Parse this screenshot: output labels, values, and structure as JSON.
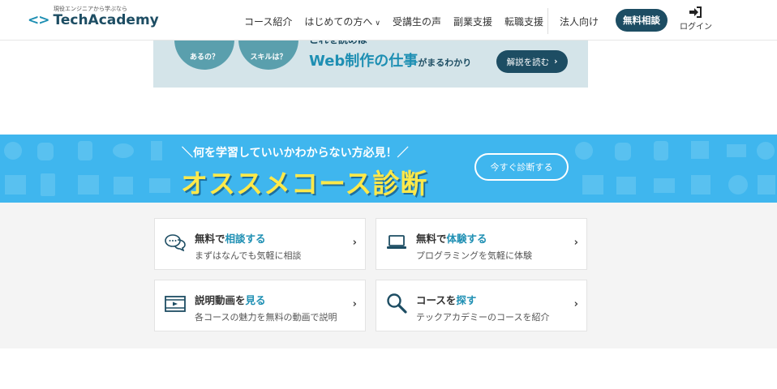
{
  "header": {
    "logo_tagline": "現役エンジニアから学ぶなら",
    "logo_mark": "<>",
    "logo_name": "TechAcademy",
    "nav": [
      {
        "label": "コース紹介"
      },
      {
        "label": "はじめての方へ",
        "has_dropdown": true
      },
      {
        "label": "受講生の声"
      },
      {
        "label": "副業支援"
      },
      {
        "label": "転職支援"
      }
    ],
    "chevron_glyph": "∨",
    "corporate_link": "法人向け",
    "consult_button": "無料相談",
    "login_label": "ログイン",
    "login_icon": "sign-in-icon"
  },
  "top_banner": {
    "circle_1": "あるの？",
    "circle_2": "スキルは？",
    "small_text": "これを読めば",
    "big_text": "Web制作の仕事",
    "big_suffix": "がまるわかり",
    "button_label": "解説を読む",
    "button_arrow": "›"
  },
  "diagnosis_banner": {
    "subtitle": "＼何を学習していいかわからない方必見！／",
    "title": "オススメコース診断",
    "button_label": "今すぐ診断する"
  },
  "cards": [
    {
      "title_prefix": "無料で",
      "title_highlight": "相談する",
      "description": "まずはなんでも気軽に相談",
      "icon": "chat-bubbles-icon"
    },
    {
      "title_prefix": "無料で",
      "title_highlight": "体験する",
      "description": "プログラミングを気軽に体験",
      "icon": "laptop-icon"
    },
    {
      "title_prefix": "説明動画を",
      "title_highlight": "見る",
      "description": "各コースの魅力を無料の動画で説明",
      "icon": "video-icon"
    },
    {
      "title_prefix": "コースを",
      "title_highlight": "探す",
      "description": "テックアカデミーのコースを紹介",
      "icon": "search-icon"
    }
  ],
  "card_chevron": "›",
  "colors": {
    "brand_dark": "#1d4d63",
    "brand_accent": "#1e8fb3",
    "diagnosis_bg": "#3fb6ee",
    "diagnosis_title": "#ffe94a",
    "cards_bg": "#f4f4f4"
  }
}
